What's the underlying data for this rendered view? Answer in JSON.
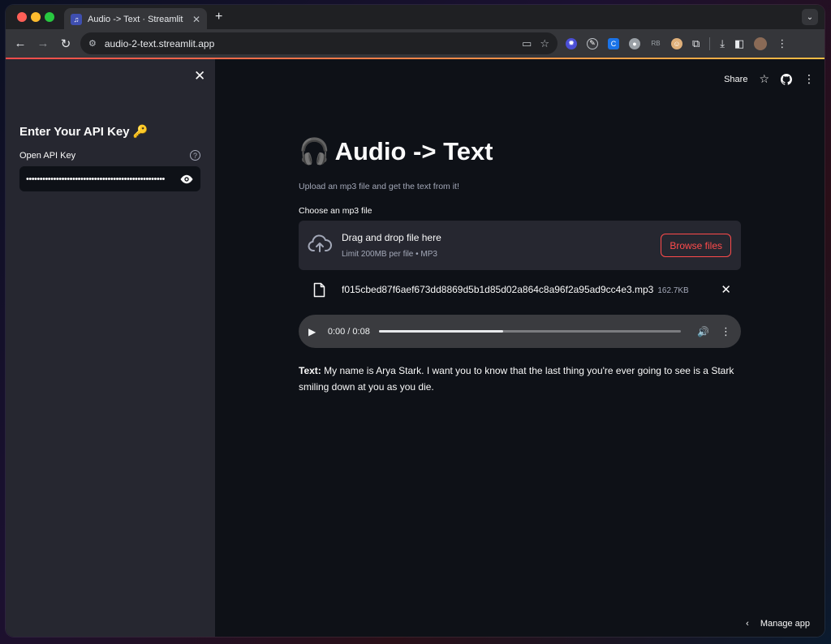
{
  "browser": {
    "tab_title": "Audio -> Text · Streamlit",
    "tab_icon": "♫",
    "new_tab": "+",
    "url": "audio-2-text.streamlit.app"
  },
  "sidebar": {
    "title": "Enter Your API Key",
    "title_emoji": "🔑",
    "api_label": "Open API Key",
    "api_value": "•••••••••••••••••••••••••••••••••••••••••••••••••••"
  },
  "header": {
    "share": "Share"
  },
  "main": {
    "title_emoji": "🎧",
    "title": "Audio -> Text",
    "caption": "Upload an mp3 file and get the text from it!",
    "uploader": {
      "label": "Choose an mp3 file",
      "drag_text": "Drag and drop file here",
      "limit_text": "Limit 200MB per file • MP3",
      "browse_label": "Browse files"
    },
    "file": {
      "name": "f015cbed87f6aef673dd8869d5b1d85d02a864c8a96f2a95ad9cc4e3.mp3",
      "size": "162.7KB"
    },
    "audio": {
      "time": "0:00 / 0:08",
      "progress": 0.41
    },
    "transcript": {
      "label": "Text:",
      "text": " My name is Arya Stark. I want you to know that the last thing you're ever going to see is a Stark smiling down at you as you die."
    }
  },
  "footer": {
    "manage": "Manage app"
  },
  "colors": {
    "accent": "#ff4b4b",
    "background": "#0e1117",
    "sidebar": "#262730"
  }
}
